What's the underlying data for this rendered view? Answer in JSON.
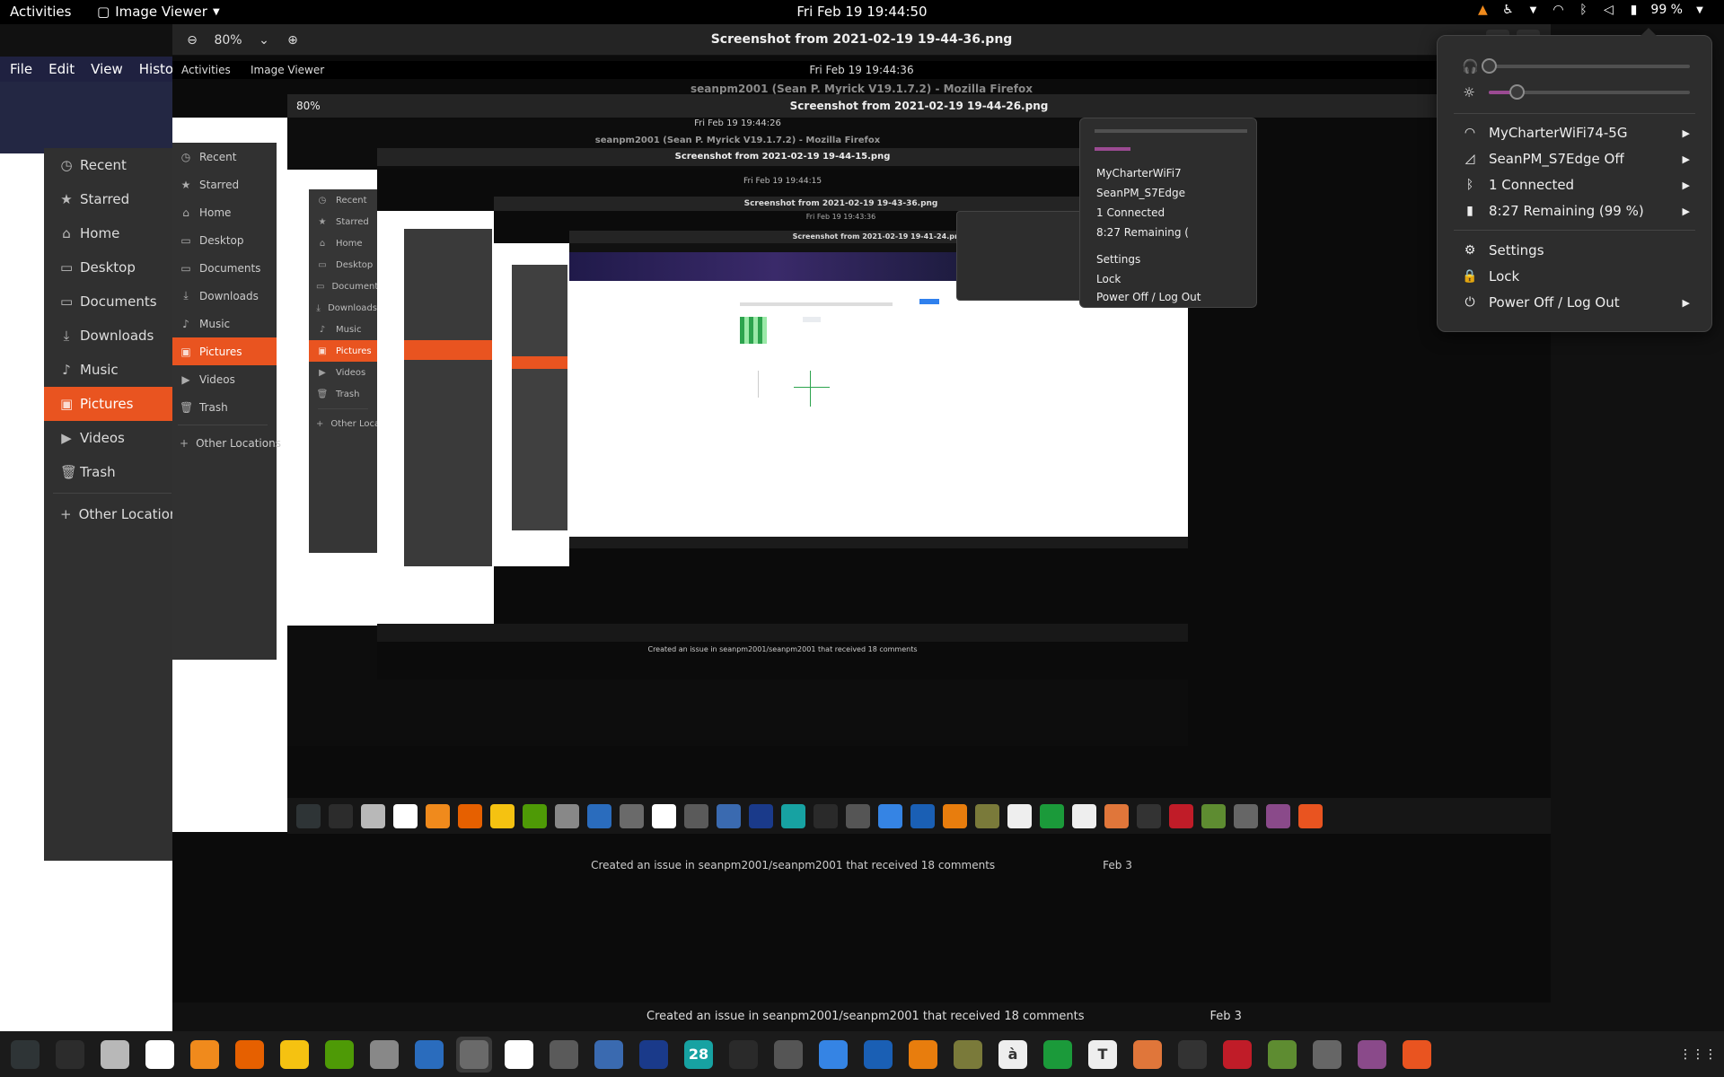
{
  "topbar": {
    "activities": "Activities",
    "app_name": "Image Viewer",
    "clock": "Fri Feb 19  19:44:50",
    "battery": "99 %"
  },
  "firefox_window_title": "seanpm2001 (Sean P. Myrick V19.1.7.2) - Mozilla Firefox",
  "viewer": {
    "zoom": "80%",
    "title": "Screenshot from 2021-02-19 19-44-36.png"
  },
  "firefox_menu": [
    "File",
    "Edit",
    "View",
    "Histo"
  ],
  "files_sidebar": [
    {
      "label": "Recent",
      "icon": "clock-icon"
    },
    {
      "label": "Starred",
      "icon": "star-icon"
    },
    {
      "label": "Home",
      "icon": "home-icon"
    },
    {
      "label": "Desktop",
      "icon": "folder-icon"
    },
    {
      "label": "Documents",
      "icon": "folder-icon"
    },
    {
      "label": "Downloads",
      "icon": "download-icon"
    },
    {
      "label": "Music",
      "icon": "music-icon"
    },
    {
      "label": "Pictures",
      "icon": "picture-icon",
      "active": true
    },
    {
      "label": "Videos",
      "icon": "video-icon"
    },
    {
      "label": "Trash",
      "icon": "trash-icon"
    },
    {
      "label": "Other Locations",
      "icon": "plus-icon"
    }
  ],
  "nested": [
    {
      "clock": "Fri Feb 19  19:44:36",
      "title": "Screenshot from 2021-02-19 19-44-26.png"
    },
    {
      "clock": "Fri Feb 19  19:44:26",
      "title": "Screenshot from 2021-02-19 19-44-15.png"
    },
    {
      "clock": "Fri Feb 19  19:44:15",
      "title": "Screenshot from 2021-02-19 19-43-36.png"
    },
    {
      "clock": "Fri Feb 19  19:43:36",
      "title": "Screenshot from 2021-02-19 19-41-24.png"
    }
  ],
  "activity_caption": "Created an issue in seanpm2001/seanpm2001 that received 18 comments",
  "activity_date": "Feb 3",
  "system_menu": {
    "wifi": "MyCharterWiFi74-5G",
    "hotspot": "SeanPM_S7Edge Off",
    "bluetooth": "1 Connected",
    "battery": "8:27 Remaining (99 %)",
    "settings": "Settings",
    "lock": "Lock",
    "power": "Power Off / Log Out",
    "volume_level": 0.0,
    "brightness_level": 0.14
  },
  "nested_menu": {
    "wifi": "MyCharterWiFi7",
    "hotspot": "SeanPM_S7Edge",
    "bluetooth": "1 Connected",
    "battery": "8:27 Remaining (",
    "settings": "Settings",
    "lock": "Lock",
    "power": "Power Off / Log Out"
  },
  "dock_apps": [
    {
      "name": "system-monitor-icon",
      "color": "#2e3436"
    },
    {
      "name": "terminal-icon",
      "color": "#2c2c2c"
    },
    {
      "name": "files-icon",
      "color": "#b8b8b8"
    },
    {
      "name": "text-editor-icon",
      "color": "#ffffff"
    },
    {
      "name": "vlc-icon",
      "color": "#f08a1c"
    },
    {
      "name": "firefox-icon",
      "color": "#e66000"
    },
    {
      "name": "notes-icon",
      "color": "#f5c211"
    },
    {
      "name": "puzzle-icon",
      "color": "#4e9a06"
    },
    {
      "name": "settings-icon",
      "color": "#888888"
    },
    {
      "name": "writer-icon",
      "color": "#2a6cbd"
    },
    {
      "name": "image-viewer-icon",
      "color": "#6a6a6a"
    },
    {
      "name": "graph-icon",
      "color": "#ffffff"
    },
    {
      "name": "inkscape-icon",
      "color": "#5a5a5a"
    },
    {
      "name": "scanner-icon",
      "color": "#3a6ab0"
    },
    {
      "name": "clementine-icon",
      "color": "#1a3a8a"
    },
    {
      "name": "calendar-icon",
      "color": "#17a2a2"
    },
    {
      "name": "diamond-icon",
      "color": "#2a2a2a"
    },
    {
      "name": "clock-app-icon",
      "color": "#555555"
    },
    {
      "name": "screenshot-icon",
      "color": "#3584e4"
    },
    {
      "name": "virtualbox-icon",
      "color": "#1a5fb4"
    },
    {
      "name": "blender-icon",
      "color": "#e87d0d"
    },
    {
      "name": "gimp-icon",
      "color": "#7a7a3a"
    },
    {
      "name": "document-icon",
      "color": "#eeeeee"
    },
    {
      "name": "calc-icon",
      "color": "#1b9a3a"
    },
    {
      "name": "typora-icon",
      "color": "#eeeeee"
    },
    {
      "name": "office-icon",
      "color": "#e0763a"
    },
    {
      "name": "bird-icon",
      "color": "#333333"
    },
    {
      "name": "mario-icon",
      "color": "#c01c28"
    },
    {
      "name": "minecraft-icon",
      "color": "#5e8c31"
    },
    {
      "name": "map-pin-icon",
      "color": "#666666"
    },
    {
      "name": "toggle-icon",
      "color": "#8a4a8a"
    },
    {
      "name": "software-center-icon",
      "color": "#e95420"
    }
  ],
  "dock_glyphs": {
    "calendar-icon": "28",
    "typora-icon": "T",
    "document-icon": "à"
  },
  "dock_active_index": 10
}
